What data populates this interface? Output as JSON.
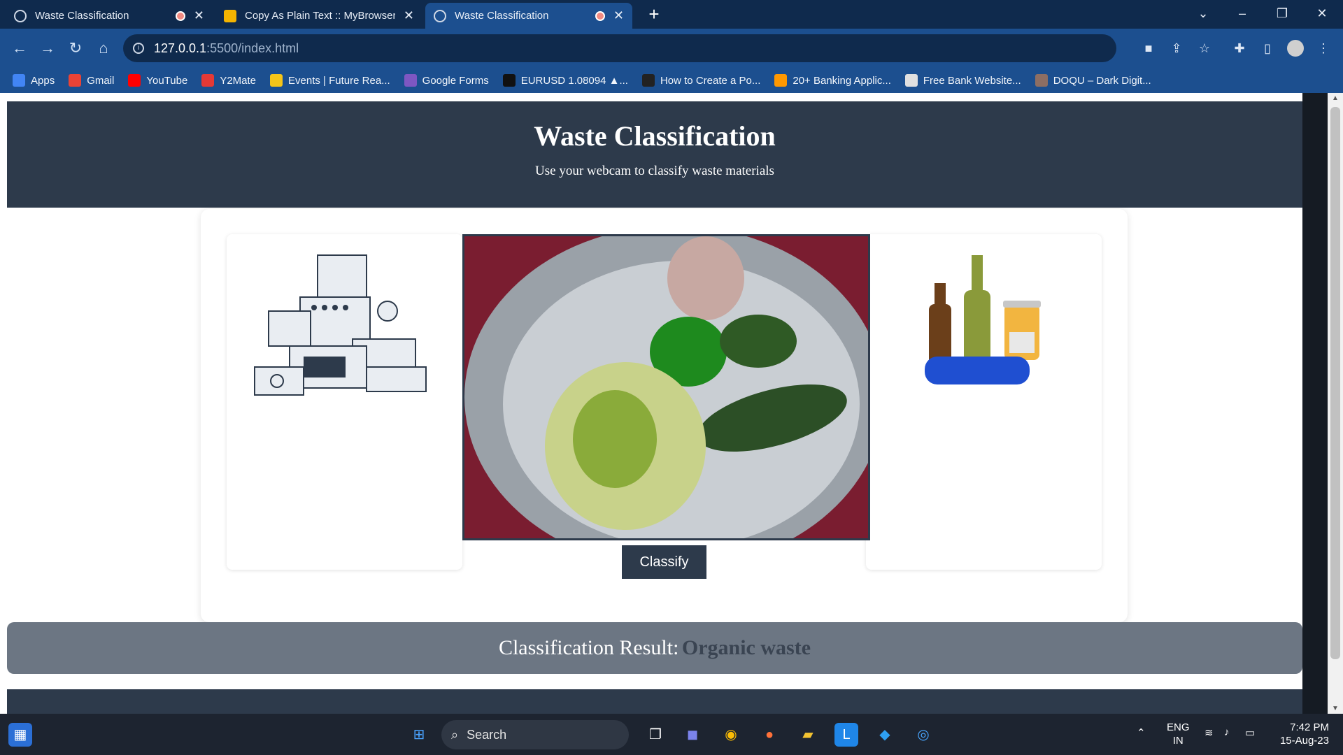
{
  "browser": {
    "tabs": [
      {
        "title": "Waste Classification",
        "active": false,
        "recording": true
      },
      {
        "title": "Copy As Plain Text :: MyBrowserA",
        "active": false,
        "recording": false
      },
      {
        "title": "Waste Classification",
        "active": true,
        "recording": true
      }
    ],
    "url_host": "127.0.0.1",
    "url_rest": ":5500/index.html",
    "bookmarks": [
      {
        "label": "Apps",
        "icon": "apps-grid-icon",
        "color": "#4285f4"
      },
      {
        "label": "Gmail",
        "icon": "gmail-icon",
        "color": "#ea4335"
      },
      {
        "label": "YouTube",
        "icon": "youtube-icon",
        "color": "#ff0000"
      },
      {
        "label": "Y2Mate",
        "icon": "y2mate-icon",
        "color": "#e53935"
      },
      {
        "label": "Events | Future Rea...",
        "icon": "events-icon",
        "color": "#f5c518"
      },
      {
        "label": "Google Forms",
        "icon": "google-forms-icon",
        "color": "#7e57c2"
      },
      {
        "label": "EURUSD 1.08094 ▲...",
        "icon": "tradingview-icon",
        "color": "#111111"
      },
      {
        "label": "How to Create a Po...",
        "icon": "code-icon",
        "color": "#222222"
      },
      {
        "label": "20+ Banking Applic...",
        "icon": "banking-icon",
        "color": "#ff9800"
      },
      {
        "label": "Free Bank Website...",
        "icon": "bank-site-icon",
        "color": "#e0e0e0"
      },
      {
        "label": "DOQU – Dark Digit...",
        "icon": "doqu-icon",
        "color": "#8d6e63"
      }
    ]
  },
  "page": {
    "title": "Waste Classification",
    "subtitle": "Use your webcam to classify waste materials",
    "classify_label": "Classify",
    "result_label": "Classification Result:",
    "result_value": "Organic waste"
  },
  "taskbar": {
    "search_label": "Search",
    "lang_top": "ENG",
    "lang_bottom": "IN",
    "time": "7:42 PM",
    "date": "15-Aug-23"
  },
  "colors": {
    "header_bg": "#2d3a4b",
    "result_bg": "#6c7683",
    "browser_accent": "#1c4f8f"
  }
}
